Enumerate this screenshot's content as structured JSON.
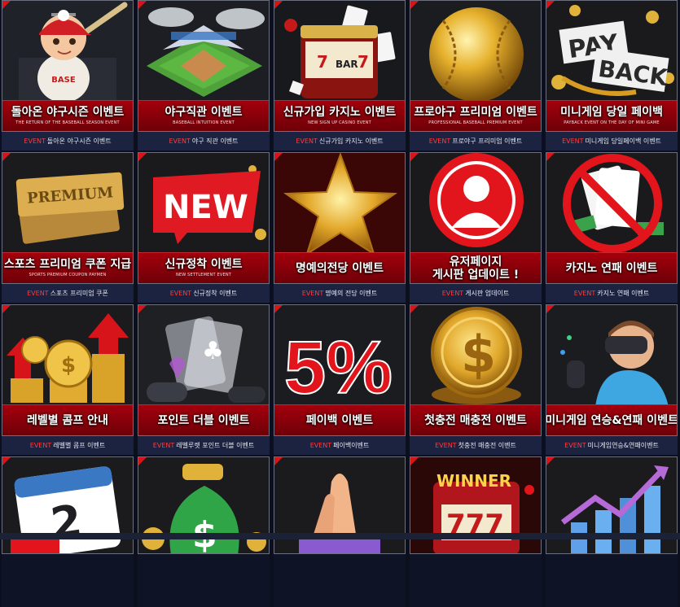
{
  "colors": {
    "accent": "#d8141b",
    "banner": "#a3000c",
    "caption_bg": "#1c2340",
    "event": "#ff3b3b"
  },
  "caption_prefix": "EVENT",
  "cards": [
    {
      "title": "돌아온 야구시즌 이벤트",
      "subtitle": "THE RETURN OF THE BASEBALL SEASON EVENT",
      "caption": "돌아온 야구시즌 이벤트",
      "icon": "baseball-player-icon"
    },
    {
      "title": "야구직관 이벤트",
      "subtitle": "BASEBALL INTUITION EVENT",
      "caption": "야구 직관 이벤트",
      "icon": "stadium-icon"
    },
    {
      "title": "신규가입 카지노 이벤트",
      "subtitle": "NEW SIGN UP CASINO EVENT",
      "caption": "신규가입 카지노 이벤트",
      "icon": "slot-machine-icon"
    },
    {
      "title": "프로야구 프리미엄 이벤트",
      "subtitle": "PROFESSIONAL BASEBALL PREMIUM EVENT",
      "caption": "프로야구 프리미엄 이벤트",
      "icon": "golden-baseball-icon"
    },
    {
      "title": "미니게임 당일 페이백",
      "subtitle": "PAYBACK EVENT ON THE DAY OF MINI GAME",
      "caption": "미니게임 당일페이백 이벤트",
      "icon": "payback-icon",
      "art_text": [
        "PAY",
        "BACK"
      ]
    },
    {
      "title": "스포츠 프리미엄 쿠폰 지급",
      "subtitle": "SPORTS PREMIUM COUPON PAYMEN",
      "caption": "스포츠 프리미엄 쿠폰",
      "icon": "premium-coupon-icon",
      "art_text": [
        "PREMIUM"
      ]
    },
    {
      "title": "신규정착 이벤트",
      "subtitle": "NEW SETTLEMENT EVENT",
      "caption": "신규정착 이벤트",
      "icon": "new-badge-icon",
      "art_text": [
        "NEW"
      ]
    },
    {
      "title": "명예의전당 이벤트",
      "subtitle": "",
      "caption": "명예의 전당 이벤트",
      "icon": "gold-star-icon"
    },
    {
      "title": "유저페이지",
      "title2": "게시판 업데이트 !",
      "subtitle": "",
      "caption": "게시판 업데이트",
      "icon": "user-profile-icon"
    },
    {
      "title": "카지노 연패 이벤트",
      "subtitle": "",
      "caption": "카지노 연패 이벤트",
      "icon": "no-cards-icon"
    },
    {
      "title": "레벨별 콤프 안내",
      "subtitle": "",
      "caption": "레벨별 콤프 이벤트",
      "icon": "coin-stacks-icon"
    },
    {
      "title": "포인트 더블 이벤트",
      "subtitle": "",
      "caption": "레벨루렛 포인트 더블 이벤트",
      "icon": "glass-cards-icon"
    },
    {
      "title": "페이백 이벤트",
      "subtitle": "",
      "caption": "페이백이벤트",
      "icon": "five-percent-icon",
      "art_text": [
        "5%"
      ]
    },
    {
      "title": "첫충전 매충전 이벤트",
      "subtitle": "",
      "caption": "첫충전 매충전 이벤트",
      "icon": "gold-coin-icon"
    },
    {
      "title": "미니게임 연승&연패 이벤트",
      "subtitle": "",
      "caption": "미니게임연승&연패이벤트",
      "icon": "vr-player-icon"
    },
    {
      "icon": "calendar-icon",
      "art_text": [
        "2"
      ]
    },
    {
      "icon": "money-bag-icon"
    },
    {
      "icon": "clapping-hands-icon"
    },
    {
      "icon": "winner-slot-icon",
      "art_text": [
        "WINNER",
        "777"
      ]
    },
    {
      "icon": "growth-chart-icon"
    }
  ]
}
